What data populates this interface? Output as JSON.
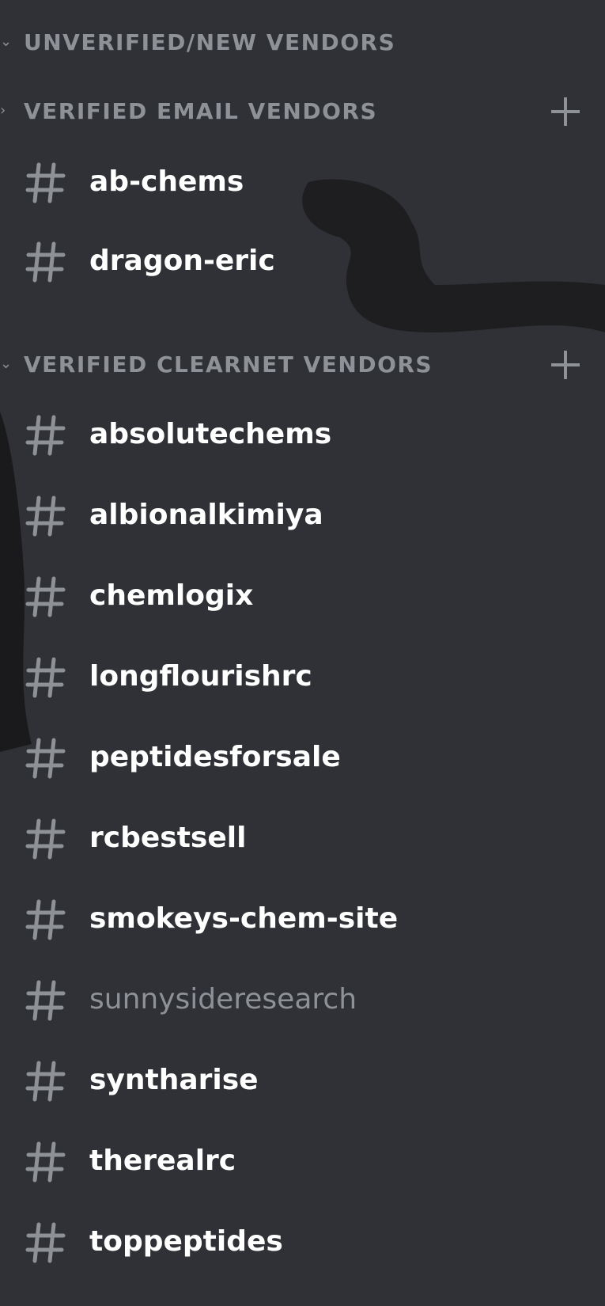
{
  "categories": {
    "unverified": {
      "label": "UNVERIFIED/NEW VENDORS",
      "state": "expanded"
    },
    "email": {
      "label": "VERIFIED EMAIL VENDORS",
      "state": "collapsed"
    },
    "clearnet": {
      "label": "VERIFIED CLEARNET VENDORS",
      "state": "expanded"
    }
  },
  "email_channels": [
    {
      "name": "ab-chems"
    },
    {
      "name": "dragon-eric"
    }
  ],
  "clearnet_channels": [
    {
      "name": "absolutechems"
    },
    {
      "name": "albionalkimiya"
    },
    {
      "name": "chemlogix"
    },
    {
      "name": "longflourishrc"
    },
    {
      "name": "peptidesforsale"
    },
    {
      "name": "rcbestsell"
    },
    {
      "name": "smokeys-chem-site"
    },
    {
      "name": "sunnysideresearch",
      "muted": true
    },
    {
      "name": "syntharise"
    },
    {
      "name": "therealrc"
    },
    {
      "name": "toppeptides"
    }
  ],
  "icons": {
    "channel": "hashtag-icon",
    "add": "plus-icon",
    "collapsed": "chevron-right-icon",
    "expanded": "chevron-down-icon"
  },
  "colors": {
    "background": "#2f3136",
    "category_text": "#8e9297",
    "channel_text": "#ffffff",
    "muted_channel_text": "#8e9297"
  }
}
